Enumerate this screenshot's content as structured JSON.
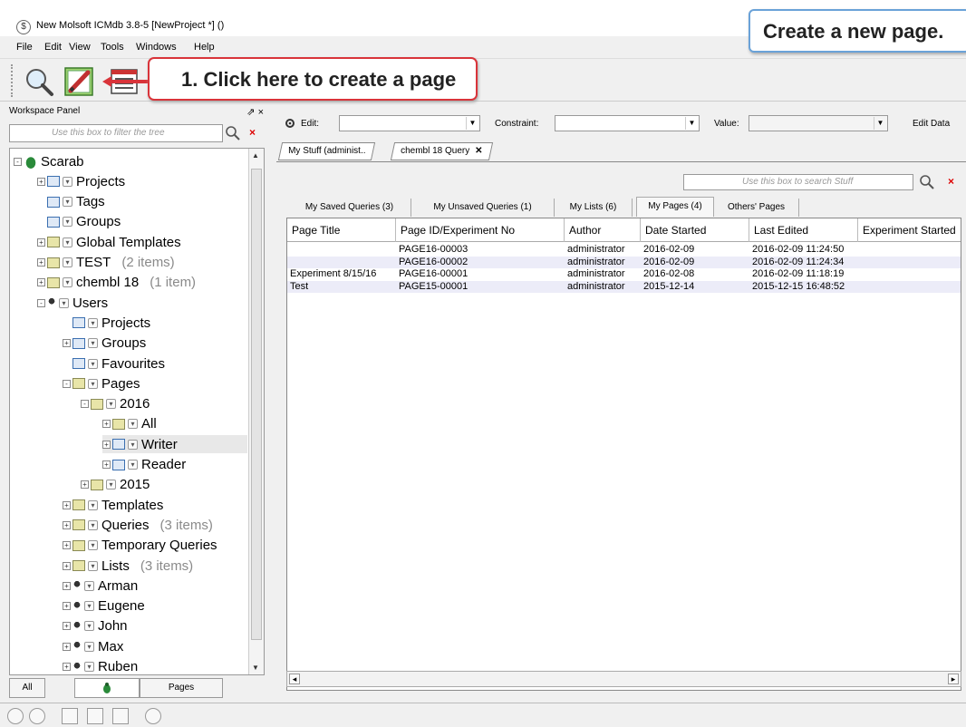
{
  "window": {
    "title": "New Molsoft ICMdb 3.8-5  [NewProject *] ()",
    "app_icon": "$"
  },
  "callouts": {
    "top": "Create a new page.",
    "step1": "1. Click here to create a page"
  },
  "menu": [
    "File",
    "Edit",
    "View",
    "Tools",
    "Windows",
    "Help"
  ],
  "toolbar": {
    "buttons": [
      "search-icon",
      "new-page-icon",
      "table-icon"
    ]
  },
  "workspace": {
    "title": "Workspace Panel",
    "window_controls": "⇗ ×",
    "filter_placeholder": "Use this box to filter the tree",
    "tree": [
      {
        "label": "Scarab",
        "level": 0,
        "icon": "bug",
        "exp": "-"
      },
      {
        "label": "Projects",
        "level": 1,
        "icon": "table",
        "exp": "+"
      },
      {
        "label": "Tags",
        "level": 1,
        "icon": "table",
        "exp": ""
      },
      {
        "label": "Groups",
        "level": 1,
        "icon": "table",
        "exp": ""
      },
      {
        "label": "Global Templates",
        "level": 1,
        "icon": "template",
        "exp": "+"
      },
      {
        "label": "TEST",
        "count": "(2 items)",
        "level": 1,
        "icon": "folder",
        "exp": "+"
      },
      {
        "label": "chembl 18",
        "count": "(1 item)",
        "level": 1,
        "icon": "folder",
        "exp": "+"
      },
      {
        "label": "Users",
        "level": 1,
        "icon": "user",
        "exp": "-"
      },
      {
        "label": "Projects",
        "level": 2,
        "icon": "table",
        "exp": ""
      },
      {
        "label": "Groups",
        "level": 2,
        "icon": "table",
        "exp": "+"
      },
      {
        "label": "Favourites",
        "level": 2,
        "icon": "table",
        "exp": ""
      },
      {
        "label": "Pages",
        "level": 2,
        "icon": "folder",
        "exp": "-"
      },
      {
        "label": "2016",
        "level": 3,
        "icon": "folder",
        "exp": "-"
      },
      {
        "label": "All",
        "level": 4,
        "icon": "folder",
        "exp": "+"
      },
      {
        "label": "Writer",
        "level": 4,
        "icon": "table",
        "exp": "+",
        "selected": true
      },
      {
        "label": "Reader",
        "level": 4,
        "icon": "table",
        "exp": "+"
      },
      {
        "label": "2015",
        "level": 3,
        "icon": "folder",
        "exp": "+"
      },
      {
        "label": "Templates",
        "level": 2,
        "icon": "template",
        "exp": "+"
      },
      {
        "label": "Queries",
        "count": "(3 items)",
        "level": 2,
        "icon": "folder",
        "exp": "+"
      },
      {
        "label": "Temporary Queries",
        "level": 2,
        "icon": "folder",
        "exp": "+"
      },
      {
        "label": "Lists",
        "count": "(3 items)",
        "level": 2,
        "icon": "folder",
        "exp": "+"
      },
      {
        "label": "Arman",
        "level": 2,
        "icon": "user",
        "exp": "+"
      },
      {
        "label": "Eugene",
        "level": 2,
        "icon": "user",
        "exp": "+"
      },
      {
        "label": "John",
        "level": 2,
        "icon": "user",
        "exp": "+"
      },
      {
        "label": "Max",
        "level": 2,
        "icon": "user",
        "exp": "+"
      },
      {
        "label": "Ruben",
        "level": 2,
        "icon": "user",
        "exp": "+"
      }
    ],
    "tabs": [
      "All",
      "",
      "Pages"
    ]
  },
  "editbar": {
    "edit_label": "Edit:",
    "constraint_label": "Constraint:",
    "value_label": "Value:",
    "edit_data": "Edit Data"
  },
  "doc_tabs": [
    "My Stuff (administ..",
    "chembl 18 Query"
  ],
  "stuff": {
    "search_placeholder": "Use this box to search Stuff",
    "tabs": [
      "My Saved Queries (3)",
      "My Unsaved Queries (1)",
      "My Lists (6)",
      "My Pages (4)",
      "Others' Pages"
    ],
    "active_tab": 3,
    "columns": [
      "Page Title",
      "Page ID/Experiment No",
      "Author",
      "Date Started",
      "Last Edited",
      "Experiment Started"
    ],
    "rows": [
      [
        "",
        "PAGE16-00003",
        "administrator",
        "2016-02-09",
        "2016-02-09 11:24:50",
        ""
      ],
      [
        "",
        "PAGE16-00002",
        "administrator",
        "2016-02-09",
        "2016-02-09 11:24:34",
        ""
      ],
      [
        "Experiment 8/15/16",
        "PAGE16-00001",
        "administrator",
        "2016-02-08",
        "2016-02-09 11:18:19",
        ""
      ],
      [
        "Test",
        "PAGE15-00001",
        "administrator",
        "2015-12-14",
        "2015-12-15 16:48:52",
        ""
      ]
    ]
  },
  "colors": {
    "callout_blue": "#6aa2d8",
    "callout_red": "#d9343a",
    "row_alt": "#ececf8"
  }
}
